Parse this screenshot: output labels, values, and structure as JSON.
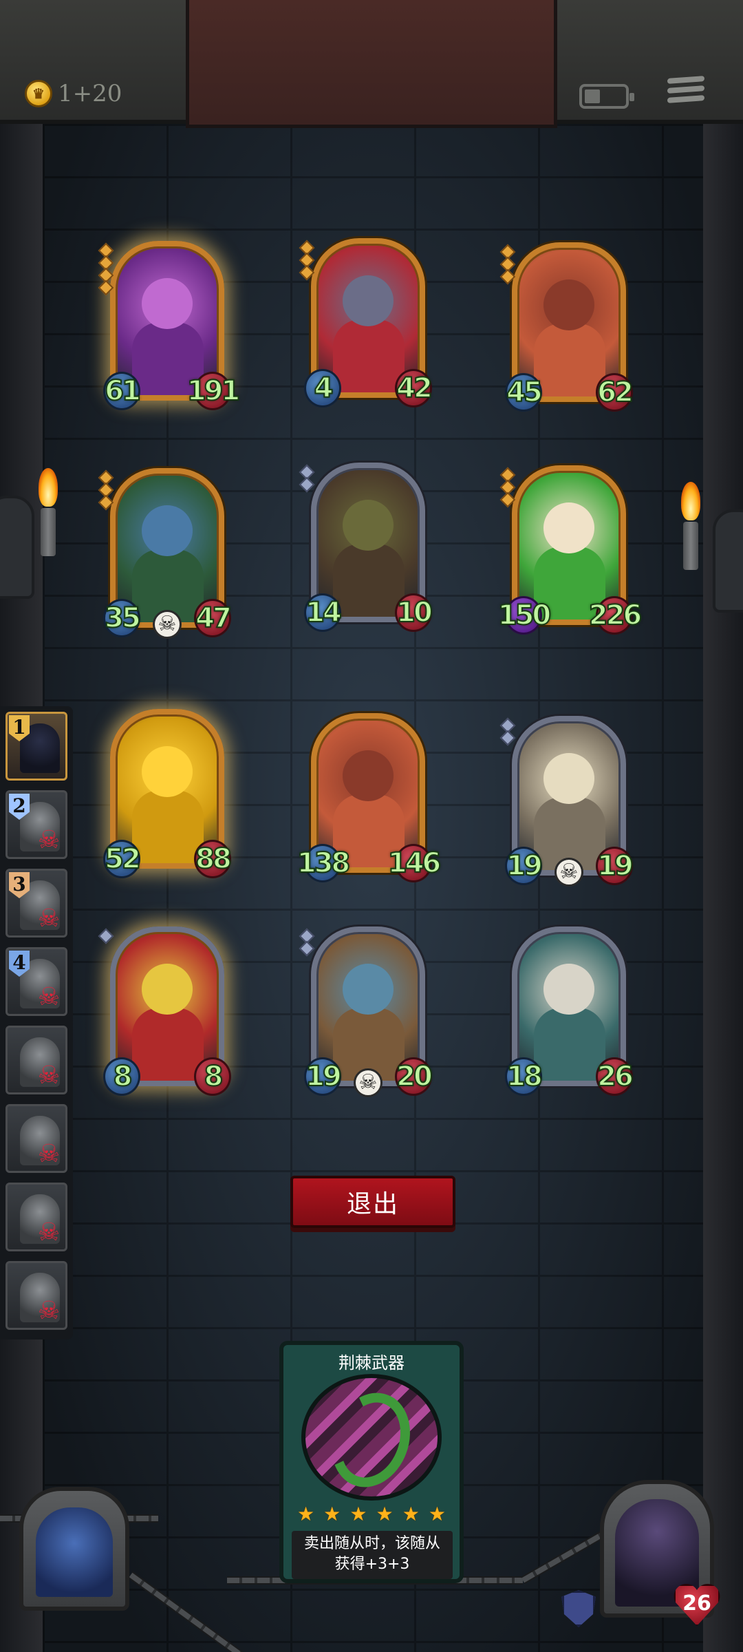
{
  "hud": {
    "gold_text": "1+20",
    "icons": [
      "crown-coin-icon",
      "battery-icon",
      "menu-icon"
    ]
  },
  "roster": [
    {
      "rank": "1",
      "eliminated": false,
      "rank_color": "#e8b84a"
    },
    {
      "rank": "2",
      "eliminated": true,
      "rank_color": "#9fc4ff"
    },
    {
      "rank": "3",
      "eliminated": true,
      "rank_color": "#e6b07a"
    },
    {
      "rank": "4",
      "eliminated": true,
      "rank_color": "#7aa6e6"
    },
    {
      "rank": "",
      "eliminated": true
    },
    {
      "rank": "",
      "eliminated": true
    },
    {
      "rank": "",
      "eliminated": true
    },
    {
      "rank": "",
      "eliminated": true
    }
  ],
  "minions": [
    {
      "attack": "61",
      "health": "191",
      "frame": "gold",
      "pips": 4,
      "glow": true,
      "art": [
        "#c06ad0",
        "#6a2a88"
      ]
    },
    {
      "attack": "4",
      "health": "42",
      "frame": "gold",
      "pips": 3,
      "glow": false,
      "art": [
        "#6b6d88",
        "#b02a36"
      ]
    },
    {
      "attack": "45",
      "health": "62",
      "frame": "gold",
      "pips": 3,
      "glow": false,
      "art": [
        "#8a3a2a",
        "#c45a3a"
      ]
    },
    {
      "attack": "35",
      "health": "47",
      "frame": "gold",
      "pips": 3,
      "glow": false,
      "deathrattle": true,
      "art": [
        "#4a7aa6",
        "#2d5a3a"
      ]
    },
    {
      "attack": "14",
      "health": "10",
      "frame": "silver",
      "pips": 2,
      "glow": false,
      "art": [
        "#6a6a3a",
        "#4a3a2a"
      ]
    },
    {
      "attack": "150",
      "health": "226",
      "frame": "gold",
      "pips": 3,
      "glow": false,
      "poison": true,
      "art": [
        "#f0e2c8",
        "#3fa63a"
      ]
    },
    {
      "attack": "52",
      "health": "88",
      "frame": "gold",
      "pips": 0,
      "glow": true,
      "art": [
        "#ffd23a",
        "#d09a10"
      ]
    },
    {
      "attack": "138",
      "health": "146",
      "frame": "gold",
      "pips": 0,
      "glow": false,
      "art": [
        "#8a3a2a",
        "#c45a3a"
      ]
    },
    {
      "attack": "19",
      "health": "19",
      "frame": "silver",
      "pips": 2,
      "glow": false,
      "deathrattle": true,
      "art": [
        "#e6dcc0",
        "#7a7060"
      ]
    },
    {
      "attack": "8",
      "health": "8",
      "frame": "silver",
      "pips": 1,
      "glow": true,
      "art": [
        "#e6c640",
        "#b02a2a"
      ]
    },
    {
      "attack": "19",
      "health": "20",
      "frame": "silver",
      "pips": 2,
      "glow": false,
      "deathrattle": true,
      "art": [
        "#5a8aa6",
        "#7a5a3a"
      ]
    },
    {
      "attack": "18",
      "health": "26",
      "frame": "silver",
      "pips": 0,
      "glow": false,
      "art": [
        "#d8d4c8",
        "#3a6a6a"
      ]
    }
  ],
  "exit_button": {
    "label": "退出"
  },
  "spell_card": {
    "title": "荆棘武器",
    "stars": 6,
    "description_line1": "卖出随从时，该随从",
    "description_line2": "获得+3+3"
  },
  "hero": {
    "health": "26"
  },
  "colors": {
    "gold_frame": "#c57f2a",
    "silver_frame": "#6d7386",
    "exit_red": "#b0141e",
    "stat_text": "#bff4a0"
  }
}
